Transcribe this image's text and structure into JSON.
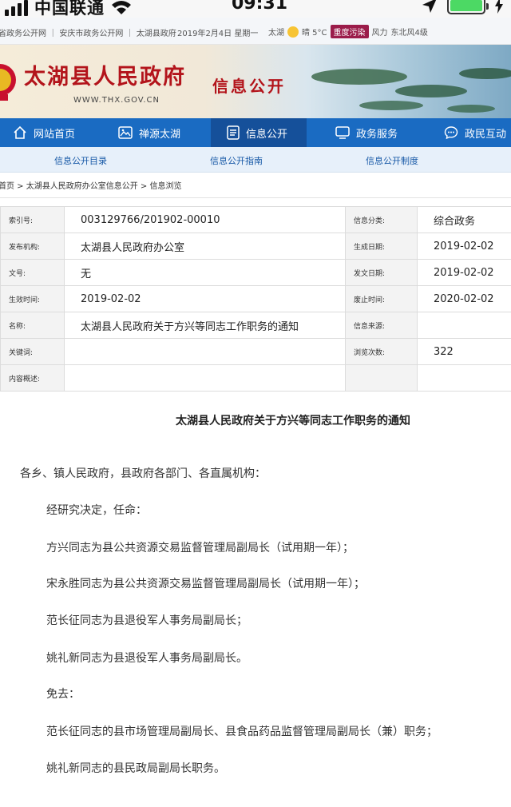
{
  "status_bar": {
    "carrier": "中国联通",
    "time": "09:31"
  },
  "top_links": {
    "links": "省政务公开网 ｜ 安庆市政务公开网 ｜ 太湖县政府",
    "date": "2019年2月4日  星期一",
    "weather_city": "太湖",
    "weather_desc": "晴 5°C",
    "pollution": "重度污染",
    "wind_label": "风力",
    "wind_value": "东北风4级"
  },
  "banner": {
    "site_title": "太湖县人民政府",
    "site_url": "WWW.THX.GOV.CN",
    "section_title": "信息公开"
  },
  "main_nav": [
    {
      "label": "网站首页",
      "icon": "home-icon"
    },
    {
      "label": "禅源太湖",
      "icon": "image-icon"
    },
    {
      "label": "信息公开",
      "icon": "document-icon"
    },
    {
      "label": "政务服务",
      "icon": "monitor-icon"
    },
    {
      "label": "政民互动",
      "icon": "chat-icon"
    }
  ],
  "sub_nav": {
    "item1": "信息公开目录",
    "item2": "信息公开指南",
    "item3": "信息公开制度"
  },
  "breadcrumb": "首页 > 太湖县人民政府办公室信息公开 > 信息浏览",
  "meta": {
    "index_label": "索引号:",
    "index_value": "003129766/201902-00010",
    "category_label": "信息分类:",
    "category_value": "综合政务",
    "publisher_label": "发布机构:",
    "publisher_value": "太湖县人民政府办公室",
    "created_label": "生成日期:",
    "created_value": "2019-02-02",
    "docno_label": "文号:",
    "docno_value": "无",
    "issued_label": "发文日期:",
    "issued_value": "2019-02-02",
    "effective_label": "生效时间:",
    "effective_value": "2019-02-02",
    "expiry_label": "废止时间:",
    "expiry_value": "2020-02-02",
    "name_label": "名称:",
    "name_value": "太湖县人民政府关于方兴等同志工作职务的通知",
    "source_label": "信息来源:",
    "source_value": "",
    "keywords_label": "关键词:",
    "keywords_value": "",
    "views_label": "浏览次数:",
    "views_value": "322",
    "summary_label": "内容概述:",
    "summary_value": ""
  },
  "article": {
    "title": "太湖县人民政府关于方兴等同志工作职务的通知",
    "salutation": "各乡、镇人民政府，县政府各部门、各直属机构：",
    "p1": "经研究决定，任命：",
    "p2": "方兴同志为县公共资源交易监督管理局副局长（试用期一年）；",
    "p3": "宋永胜同志为县公共资源交易监督管理局副局长（试用期一年）；",
    "p4": "范长征同志为县退役军人事务局副局长；",
    "p5": "姚礼新同志为县退役军人事务局副局长。",
    "p6": "免去：",
    "p7": "范长征同志的县市场管理局副局长、县食品药品监督管理局副局长（兼）职务；",
    "p8": "姚礼新同志的县民政局副局长职务。"
  }
}
